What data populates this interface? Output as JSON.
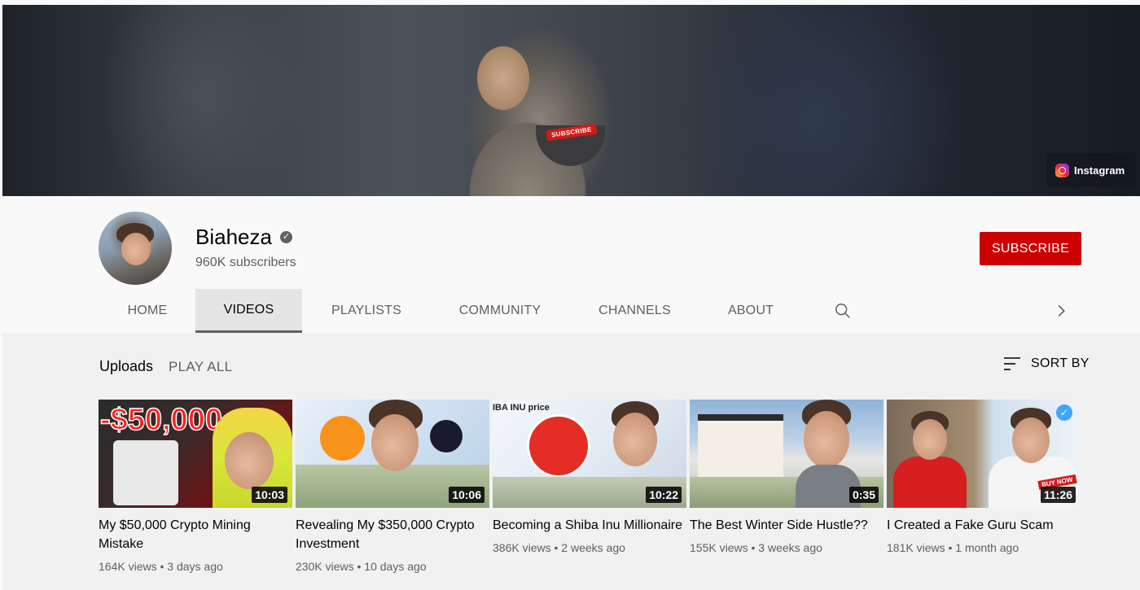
{
  "banner": {
    "bowl_text": "SUBSCRIBE",
    "link_label": "Instagram"
  },
  "channel": {
    "name": "Biaheza",
    "subscribers": "960K subscribers",
    "subscribe_label": "SUBSCRIBE"
  },
  "tabs": [
    {
      "label": "HOME"
    },
    {
      "label": "VIDEOS"
    },
    {
      "label": "PLAYLISTS"
    },
    {
      "label": "COMMUNITY"
    },
    {
      "label": "CHANNELS"
    },
    {
      "label": "ABOUT"
    }
  ],
  "active_tab": "VIDEOS",
  "section": {
    "title": "Uploads",
    "play_all": "PLAY ALL",
    "sort_label": "SORT BY"
  },
  "videos": [
    {
      "title": "My $50,000 Crypto Mining Mistake",
      "duration": "10:03",
      "views": "164K views",
      "age": "3 days ago",
      "thumb_text": "-$50,000"
    },
    {
      "title": "Revealing My $350,000 Crypto Investment",
      "duration": "10:06",
      "views": "230K views",
      "age": "10 days ago"
    },
    {
      "title": "Becoming a Shiba Inu Millionaire",
      "duration": "10:22",
      "views": "386K views",
      "age": "2 weeks ago",
      "thumb_text": "IBA INU price"
    },
    {
      "title": "The Best Winter Side Hustle??",
      "duration": "0:35",
      "views": "155K views",
      "age": "3 weeks ago"
    },
    {
      "title": "I Created a Fake Guru Scam",
      "duration": "11:26",
      "views": "181K views",
      "age": "1 month ago",
      "thumb_text": "BUY NOW"
    }
  ],
  "colors": {
    "subscribe_red": "#cc0000",
    "text_primary": "#030303",
    "text_secondary": "#606060"
  }
}
